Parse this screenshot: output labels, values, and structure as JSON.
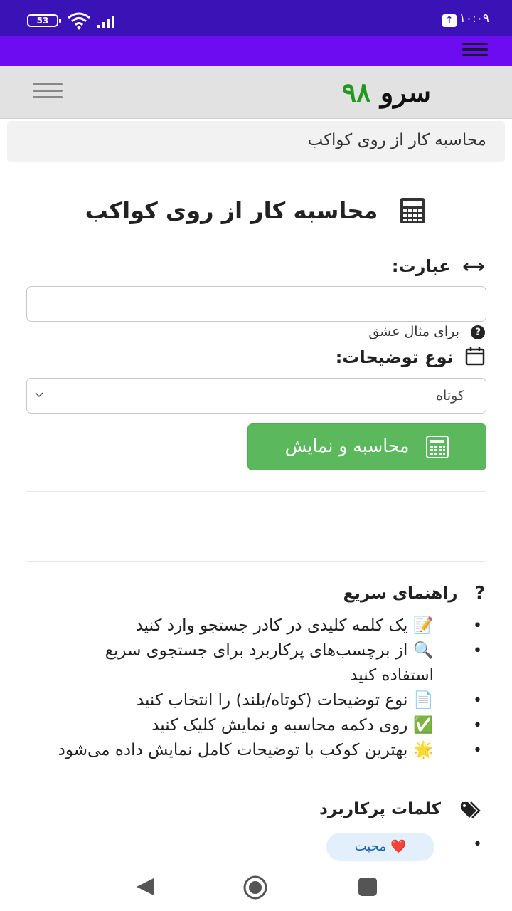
{
  "status_bar": {
    "battery": "53",
    "time": "۱۰:۰۹"
  },
  "header": {
    "logo_word": "سرو",
    "logo_number": "۹۸"
  },
  "breadcrumb": "محاسبه کار از روی کواکب",
  "page_title": "محاسبه کار از روی کواکب",
  "form": {
    "phrase_label": "عبارت:",
    "phrase_value": "",
    "hint": "برای مثال عشق",
    "type_label": "نوع توضیحات:",
    "type_selected": "کوتاه",
    "submit_label": "محاسبه و نمایش"
  },
  "guide": {
    "title": "راهنمای سریع",
    "items": [
      {
        "emoji": "📝",
        "text": "یک کلمه کلیدی در کادر جستجو وارد کنید"
      },
      {
        "emoji": "🔍",
        "text": "از برچسب‌های پرکاربرد برای جستجوی سریع استفاده کنید"
      },
      {
        "emoji": "📄",
        "text": "نوع توضیحات (کوتاه/بلند) را انتخاب کنید"
      },
      {
        "emoji": "✅",
        "text": "روی دکمه محاسبه و نمایش کلیک کنید"
      },
      {
        "emoji": "🌟",
        "text": "بهترین کوکب با توضیحات کامل نمایش داده می‌شود"
      }
    ]
  },
  "keywords": {
    "title": "کلمات پرکاربرد",
    "items": [
      {
        "emoji": "❤️",
        "label": "محبت"
      }
    ]
  },
  "colors": {
    "status_bar": "#3a12b5",
    "top_nav": "#6d0cf0",
    "header_bg": "#e2e2e2",
    "logo_number": "#1f9a1f",
    "submit_button": "#5cb85c",
    "keyword_pill_bg": "#e3f0fc",
    "keyword_pill_text": "#1e63b0"
  }
}
